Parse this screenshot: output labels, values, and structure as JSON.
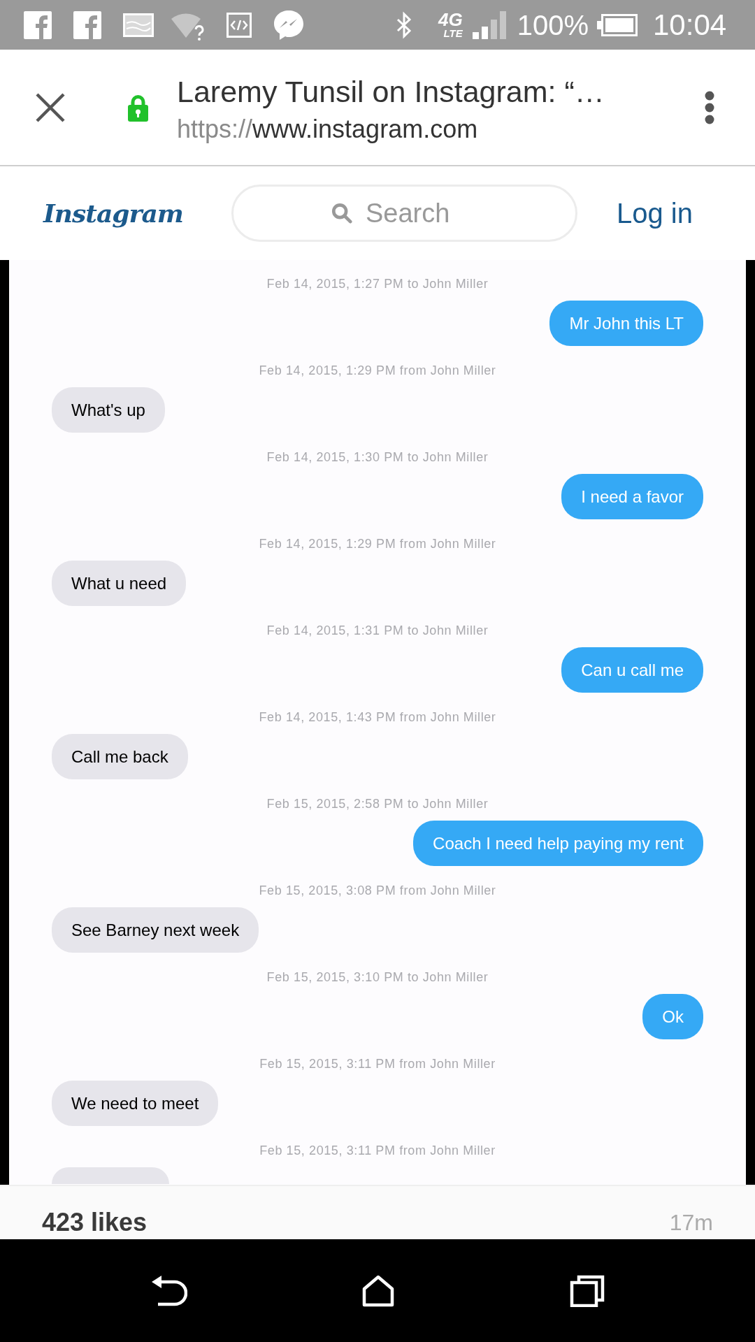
{
  "status_bar": {
    "network": "4G",
    "network_sub": "LTE",
    "battery": "100%",
    "time": "10:04"
  },
  "browser": {
    "title": "Laremy Tunsil on Instagram: “…",
    "url_scheme": "https://",
    "url_host": "www.instagram.com"
  },
  "header": {
    "logo": "Instagram",
    "search": {
      "placeholder": "Search"
    },
    "login": "Log in"
  },
  "messages": [
    {
      "timestamp": "Feb 14, 2015, 1:27 PM to John Miller",
      "kind": "sent",
      "text": "Mr John this LT"
    },
    {
      "timestamp": "Feb 14, 2015, 1:29 PM from John Miller",
      "kind": "received",
      "text": "What's up"
    },
    {
      "timestamp": "Feb 14, 2015, 1:30 PM to John Miller",
      "kind": "sent",
      "text": "I need a favor"
    },
    {
      "timestamp": "Feb 14, 2015, 1:29 PM from John Miller",
      "kind": "received",
      "text": "What u need"
    },
    {
      "timestamp": "Feb 14, 2015, 1:31 PM to John Miller",
      "kind": "sent",
      "text": "Can u call me"
    },
    {
      "timestamp": "Feb 14, 2015, 1:43 PM from John Miller",
      "kind": "received",
      "text": "Call me back"
    },
    {
      "timestamp": "Feb 15, 2015, 2:58 PM to John Miller",
      "kind": "sent",
      "text": "Coach I need help paying my rent"
    },
    {
      "timestamp": "Feb 15, 2015, 3:08 PM from John Miller",
      "kind": "received",
      "text": "See Barney next week"
    },
    {
      "timestamp": "Feb 15, 2015, 3:10 PM to John Miller",
      "kind": "sent",
      "text": "Ok"
    },
    {
      "timestamp": "Feb 15, 2015, 3:11 PM from John Miller",
      "kind": "received",
      "text": "We need to meet"
    },
    {
      "timestamp": "Feb 15, 2015, 3:11 PM from John Miller",
      "kind": "received"
    }
  ],
  "post": {
    "likes": "423 likes",
    "age": "17m"
  }
}
